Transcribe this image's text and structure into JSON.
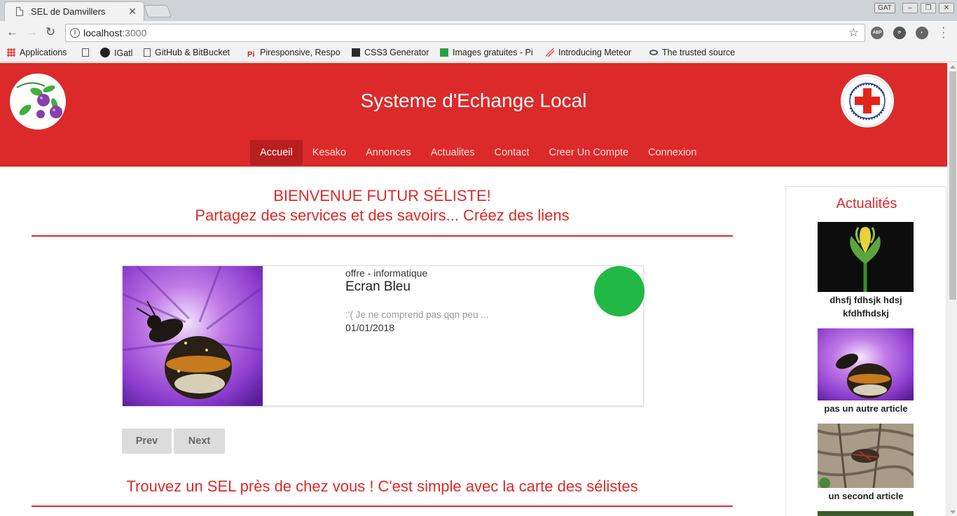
{
  "browser": {
    "tab_title": "SEL de Damvillers",
    "tab_close": "✕",
    "incognito_label": "GAT",
    "url_host": "localhost",
    "url_port": ":3000",
    "bookmarks": [
      {
        "label": "Applications",
        "icon": "apps-grid-icon"
      },
      {
        "label": "IGatl",
        "icon": "github-icon"
      },
      {
        "label": "GitHub & BitBucket",
        "icon": "page-icon"
      },
      {
        "label": "Piresponsive, Respo",
        "icon": "pi-icon"
      },
      {
        "label": "CSS3 Generator",
        "icon": "css3-icon"
      },
      {
        "label": "Images gratuites - Pi",
        "icon": "pixabay-icon"
      },
      {
        "label": "Introducing Meteor",
        "icon": "meteor-icon"
      },
      {
        "label": "The trusted source",
        "icon": "planet-icon"
      }
    ]
  },
  "header": {
    "title": "Systeme d'Echange Local",
    "nav": [
      "Accueil",
      "Kesako",
      "Annonces",
      "Actualites",
      "Contact",
      "Creer Un Compte",
      "Connexion"
    ],
    "active_nav": 0
  },
  "main": {
    "welcome_line1": "BIENVENUE FUTUR SÉLISTE!",
    "welcome_line2": "Partagez des services et des savoirs... Créez des liens",
    "card": {
      "category": "offre - informatique",
      "title": "Ecran Bleu",
      "description": ":'( Je ne comprend pas qqn peu ...",
      "date": "01/01/2018",
      "status_color": "#22b846"
    },
    "prev_label": "Prev",
    "next_label": "Next",
    "map_heading": "Trouvez un SEL près de chez vous ! C'est simple avec la carte des sélistes"
  },
  "sidebar": {
    "title": "Actualités",
    "items": [
      {
        "caption": "dhsfj fdhsjk hdsj kfdhfhdskj"
      },
      {
        "caption": "pas un autre article"
      },
      {
        "caption": "un second article"
      }
    ]
  },
  "colors": {
    "brand_red": "#dc2a2a",
    "nav_active": "#b81f1f"
  }
}
